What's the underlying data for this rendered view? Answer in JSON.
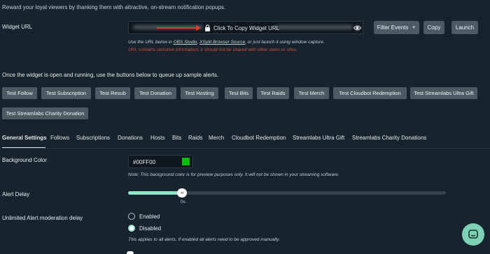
{
  "intro": "Reward your loyal viewers by thanking them with attractive, on-stream notification popups.",
  "widget_url": {
    "label": "Widget URL",
    "copy_text": "Click To Copy Widget URL",
    "help_prefix": "Use the URL below in ",
    "link_obs": "OBS Studio",
    "help_sep": ", ",
    "link_xsplit": "XSplit Browser Source",
    "help_suffix": ", or just launch it using window capture.",
    "warning": "URL contains sensitive information, it should not be shared with other users or sites.",
    "filter_label": "Filter Events",
    "copy_label": "Copy",
    "launch_label": "Launch"
  },
  "queue_text": "Once the widget is open and running, use the buttons below to queue up sample alerts.",
  "test_buttons": [
    "Test Follow",
    "Test Subscription",
    "Test Resub",
    "Test Donation",
    "Test Hosting",
    "Test Bits",
    "Test Raids",
    "Test Merch",
    "Test Cloudbot Redemption",
    "Test Streamlabs Ultra Gift",
    "Test Streamlabs Charity Donation"
  ],
  "tabs": [
    "General Settings",
    "Follows",
    "Subscriptions",
    "Donations",
    "Hosts",
    "Bits",
    "Raids",
    "Merch",
    "Cloudbot Redemption",
    "Streamlabs Ultra Gift",
    "Streamlabs Charity Donations"
  ],
  "active_tab": "General Settings",
  "background_color": {
    "label": "Background Color",
    "value": "#00FF00",
    "note": "Note: This background color is for preview purposes only. It will not be shown in your streaming software."
  },
  "alert_delay": {
    "label": "Alert Delay",
    "value_label": "0s",
    "fill_fraction": 0.17
  },
  "moderation": {
    "label": "Unlimited Alert moderation delay",
    "options": [
      "Enabled",
      "Disabled"
    ],
    "selected": "Disabled",
    "note": "This applies to all alerts. If enabled all alerts need to be approved manually."
  },
  "colors": {
    "background": "#17242d",
    "button": "#4b5a63",
    "accent": "#8fe3c8",
    "warning": "#d84b46",
    "arrow": "#e23a2a"
  },
  "icons": {
    "lock": "lock-icon",
    "eye": "eye-icon",
    "chat": "chat-icon"
  }
}
